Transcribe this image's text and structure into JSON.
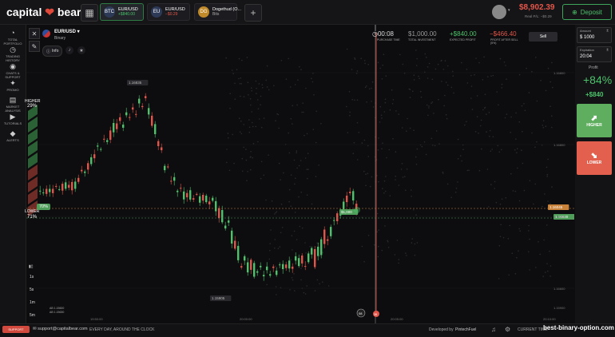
{
  "brand": {
    "name_a": "capital",
    "name_b": "bear"
  },
  "tabs": [
    {
      "icon": "BTC",
      "label": "EUR/USD",
      "value": "+$840.00",
      "active": true
    },
    {
      "icon": "EU",
      "label": "EUR/USD",
      "value": "−$0.29",
      "active": false
    },
    {
      "icon": "DG",
      "label": "Dogethud (O...",
      "value": "Bits",
      "active": false
    }
  ],
  "account": {
    "balance": "$8,902.39",
    "sub": "Real P/L: −$0.29"
  },
  "deposit_label": "Deposit",
  "asset": {
    "name": "EUR/USD",
    "type": "Binary",
    "info_label": "Info"
  },
  "trade_header": {
    "purchase_time": {
      "value": "00:08",
      "label": "PURCHASE TIME"
    },
    "total_investment": {
      "value": "$1,000.00",
      "label": "TOTAL INVESTMENT"
    },
    "expected_profit": {
      "value": "+$840.00",
      "label": "EXPECTED PROFIT"
    },
    "profit_after_sell": {
      "value": "−$466.40",
      "label": "PROFIT AFTER SELL (5%)"
    },
    "sell_label": "Sell"
  },
  "nav": [
    {
      "icon": "pie-icon",
      "glyph": "◔",
      "label": "TOTAL PORTFOLIO"
    },
    {
      "icon": "history-icon",
      "glyph": "◷",
      "label": "TRADING HISTORY"
    },
    {
      "icon": "chat-icon",
      "glyph": "◉",
      "label": "CHATS & SUPPORT"
    },
    {
      "icon": "promo-icon",
      "glyph": "✦",
      "label": "PROMO"
    },
    {
      "icon": "market-icon",
      "glyph": "▤",
      "label": "MARKET ANALYSIS"
    },
    {
      "icon": "tutorial-icon",
      "glyph": "▶",
      "label": "TUTORIALS"
    },
    {
      "icon": "alert-icon",
      "glyph": "◆",
      "label": "ALERTS"
    }
  ],
  "sentiment": {
    "higher_label": "HIGHER",
    "higher_pct": "29%",
    "lower_label": "LOWER",
    "lower_pct": "71%",
    "current": "70%"
  },
  "panel": {
    "amount_label": "Amount",
    "amount_value": "$ 1000",
    "expiration_label": "Expiration",
    "expiration_value": "20:04",
    "profit_label": "Profit",
    "profit_pct": "+84%",
    "profit_value": "+$840",
    "higher_label": "HIGHER",
    "lower_label": "LOWER"
  },
  "price_labels": {
    "high": "1.16835",
    "low": "1.15905",
    "current": "1.16045",
    "entry": "1.16620",
    "trade_badge": "$1,000",
    "axis": [
      "1.16800",
      "1.16800",
      "1.16700",
      "1.16600"
    ],
    "axis_bottom": "1.15900",
    "marker_start": "08",
    "marker_end": "38"
  },
  "time_axis": [
    "19:50:00",
    "20:00:00",
    "20:05:00",
    "20:10:00"
  ],
  "timeframes": [
    "1s",
    "5s",
    "1m",
    "5m"
  ],
  "mini": [
    "AB 1.15600",
    "AB 1.15630"
  ],
  "footer": {
    "support": "SUPPORT",
    "email": "support@capitalbear.com",
    "tagline": "EVERY DAY, AROUND THE CLOCK",
    "developed": "Developed by",
    "dev_name": "PintechFuel",
    "time_label": "CURRENT TIME",
    "watermark": "best-binary-option.com"
  },
  "colors": {
    "up": "#4cc26a",
    "down": "#e2564a",
    "accent": "#e2604d"
  }
}
